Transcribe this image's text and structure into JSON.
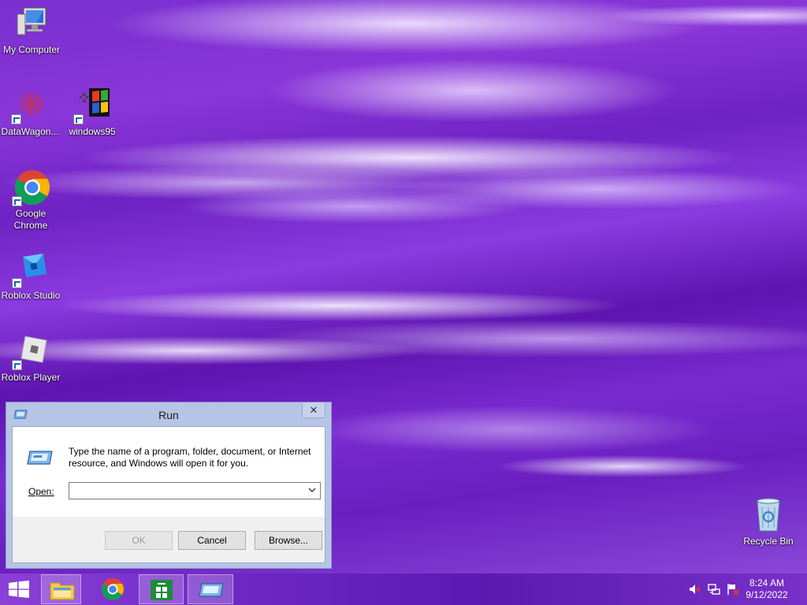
{
  "desktop": {
    "icons": [
      {
        "label": "My Computer",
        "icon": "computer-icon"
      },
      {
        "label": "DataWagon...",
        "icon": "datawagon-icon"
      },
      {
        "label": "windows95",
        "icon": "windows95-icon"
      },
      {
        "label": "Google Chrome",
        "icon": "chrome-icon"
      },
      {
        "label": "Roblox Studio",
        "icon": "roblox-studio-icon"
      },
      {
        "label": "Roblox Player",
        "icon": "roblox-player-icon"
      },
      {
        "label": "Recycle Bin",
        "icon": "recycle-bin-icon"
      }
    ]
  },
  "run_dialog": {
    "title": "Run",
    "close_label": "✕",
    "description": "Type the name of a program, folder, document, or Internet resource, and Windows will open it for you.",
    "open_label": "Open:",
    "open_value": "",
    "ok_label": "OK",
    "cancel_label": "Cancel",
    "browse_label": "Browse..."
  },
  "taskbar": {
    "items": [
      {
        "name": "start",
        "icon": "windows-logo-icon"
      },
      {
        "name": "file-explorer",
        "icon": "folder-icon",
        "active": true
      },
      {
        "name": "chrome",
        "icon": "chrome-icon",
        "active": false
      },
      {
        "name": "store",
        "icon": "store-icon",
        "active": true
      },
      {
        "name": "run",
        "icon": "run-icon",
        "active": true
      }
    ],
    "tray": [
      "volume-muted-icon",
      "network-icon",
      "action-center-flag-icon"
    ],
    "clock": {
      "time": "8:24 AM",
      "date": "9/12/2022"
    }
  },
  "colors": {
    "accent": "#7a2fd0",
    "taskbar": "#6e28c4",
    "dialog_frame": "#b6c5e6"
  }
}
